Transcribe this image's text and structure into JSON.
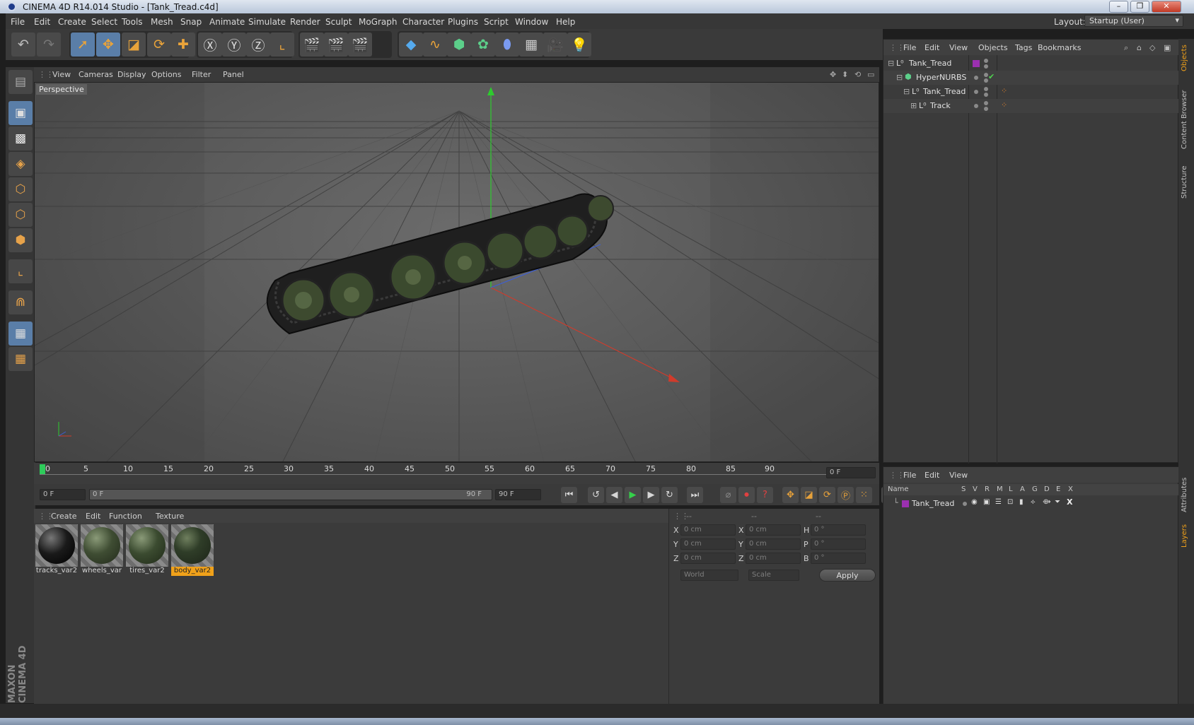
{
  "window": {
    "title": "CINEMA 4D R14.014 Studio - [Tank_Tread.c4d]"
  },
  "menubar": {
    "items": [
      "File",
      "Edit",
      "Create",
      "Select",
      "Tools",
      "Mesh",
      "Snap",
      "Animate",
      "Simulate",
      "Render",
      "Sculpt",
      "MoGraph",
      "Character",
      "Plugins",
      "Script",
      "Window",
      "Help"
    ],
    "layout_label": "Layout:",
    "layout_value": "Startup (User)"
  },
  "viewport": {
    "menu": [
      "View",
      "Cameras",
      "Display",
      "Options",
      "Filter",
      "Panel"
    ],
    "label": "Perspective"
  },
  "timeline": {
    "ticks": [
      "0",
      "5",
      "10",
      "15",
      "20",
      "25",
      "30",
      "35",
      "40",
      "45",
      "50",
      "55",
      "60",
      "65",
      "70",
      "75",
      "80",
      "85",
      "90"
    ],
    "current_frame": "0 F",
    "start_field": "0 F",
    "slider_start": "0 F",
    "slider_end": "90 F",
    "end_field": "90 F"
  },
  "materials": {
    "menu": [
      "Create",
      "Edit",
      "Function",
      "Texture"
    ],
    "items": [
      {
        "name": "tracks_var2",
        "color": "#1a1a1a"
      },
      {
        "name": "wheels_var",
        "color": "#3f4d33"
      },
      {
        "name": "tires_var2",
        "color": "#3b4b30"
      },
      {
        "name": "body_var2",
        "color": "#2f3d28"
      }
    ]
  },
  "coords": {
    "headers": [
      "--",
      "--",
      "--"
    ],
    "rows": [
      {
        "a": "X",
        "av": "0 cm",
        "b": "X",
        "bv": "0 cm",
        "c": "H",
        "cv": "0 °"
      },
      {
        "a": "Y",
        "av": "0 cm",
        "b": "Y",
        "bv": "0 cm",
        "c": "P",
        "cv": "0 °"
      },
      {
        "a": "Z",
        "av": "0 cm",
        "b": "Z",
        "bv": "0 cm",
        "c": "B",
        "cv": "0 °"
      }
    ],
    "world": "World",
    "scale": "Scale",
    "apply": "Apply"
  },
  "objects": {
    "menu": [
      "File",
      "Edit",
      "View",
      "Objects",
      "Tags",
      "Bookmarks"
    ],
    "rows": [
      {
        "name": "Tank_Tread"
      },
      {
        "name": "HyperNURBS"
      },
      {
        "name": "Tank_Tread"
      },
      {
        "name": "Track"
      }
    ]
  },
  "layers": {
    "menu": [
      "File",
      "Edit",
      "View"
    ],
    "columns": [
      "Name",
      "S",
      "V",
      "R",
      "M",
      "L",
      "A",
      "G",
      "D",
      "E",
      "X"
    ],
    "rows": [
      {
        "name": "Tank_Tread"
      }
    ]
  },
  "sidetabs": [
    "Objects",
    "Content Browser",
    "Structure",
    "Attributes",
    "Layers"
  ],
  "brand": "MAXON CINEMA 4D",
  "colors": {
    "accent": "#f0a11a",
    "selection": "#5a7ea8",
    "layer": "#9b30b0"
  }
}
